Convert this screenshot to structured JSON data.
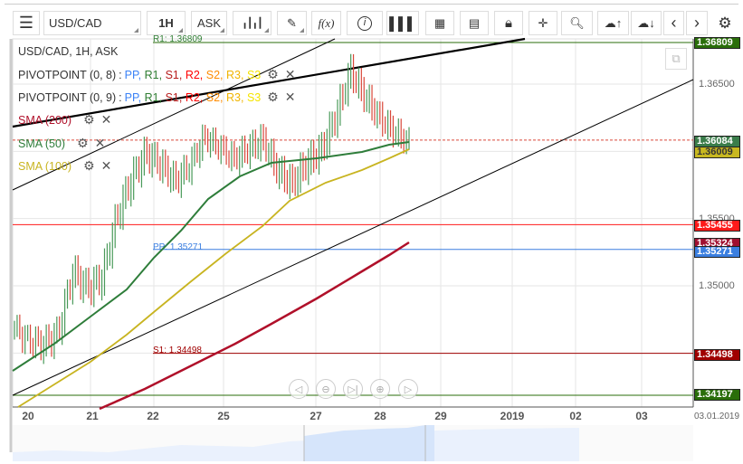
{
  "toolbar": {
    "symbol": "USD/CAD",
    "timeframe": "1H",
    "price_type": "ASK",
    "fx_label": "f(x)",
    "icons": [
      "menu-icon",
      "candle-type-icon",
      "pencil-icon",
      "function-icon",
      "info-icon",
      "bar-chart-icon",
      "calendar-icon",
      "document-icon",
      "lock-icon",
      "crosshair-icon",
      "zoom-icon",
      "upload-icon",
      "download-icon",
      "chevron-left-icon",
      "chevron-right-icon",
      "gear-icon"
    ]
  },
  "legend": {
    "title": "USD/CAD, 1H, ASK",
    "pivot1": "PIVOTPOINT (0, 8)",
    "pivot2": "PIVOTPOINT (0, 9)",
    "pivot_sep": " :",
    "pivot_items": [
      {
        "t": "PP",
        "c": "#3b82f6"
      },
      {
        "t": "R1",
        "c": "#2e7d32"
      },
      {
        "t": "S1",
        "c": "#b71c1c"
      },
      {
        "t": "R2",
        "c": "#ff0000"
      },
      {
        "t": "S2",
        "c": "#ff8c00"
      },
      {
        "t": "R3",
        "c": "#f0b400"
      },
      {
        "t": "S3",
        "c": "#f5e400"
      }
    ],
    "sma200": "SMA (200)",
    "sma50": "SMA (50)",
    "sma100": "SMA (100)"
  },
  "price_axis": {
    "ticks": [
      "1.36500",
      "1.35500",
      "1.35000"
    ]
  },
  "price_labels": [
    {
      "v": "1.36809",
      "price": 1.36809,
      "bg": "#2a6e0a"
    },
    {
      "v": "1.36084",
      "price": 1.36084,
      "bg": "#3a7d4a"
    },
    {
      "v": "1.36009",
      "price": 1.36009,
      "bg": "#c8b820",
      "fg": "#333"
    },
    {
      "v": "1.35455",
      "price": 1.35455,
      "bg": "#ff1a1a"
    },
    {
      "v": "1.35324",
      "price": 1.35324,
      "bg": "#a01030"
    },
    {
      "v": "1.35271",
      "price": 1.35271,
      "bg": "#3b7fe0"
    },
    {
      "v": "1.34498",
      "price": 1.34498,
      "bg": "#a00000"
    },
    {
      "v": "1.34197",
      "price": 1.34197,
      "bg": "#2a6e0a"
    }
  ],
  "line_labels": {
    "r1": "R1: 1.36809",
    "pp": "PP: 1.35271",
    "s1": "S1: 1.34498"
  },
  "x_axis": {
    "labels": [
      "20",
      "21",
      "22",
      "25",
      "27",
      "28",
      "29",
      "2019",
      "02",
      "03"
    ],
    "end_date": "03.01.2019"
  },
  "price_path": [
    1.347,
    1.346,
    1.3457,
    1.3465,
    1.351,
    1.3497,
    1.3505,
    1.355,
    1.3578,
    1.3598,
    1.359,
    1.3578,
    1.359,
    1.3612,
    1.3605,
    1.3595,
    1.3602,
    1.3608,
    1.3585,
    1.3575,
    1.359,
    1.36,
    1.3625,
    1.3659,
    1.364,
    1.3625,
    1.3615,
    1.3608
  ],
  "colors": {
    "up": "#4a9a5a",
    "down": "#d9483b",
    "sma50": "#2e7d3a",
    "sma100": "#c8b420",
    "sma200": "#b0102a"
  }
}
